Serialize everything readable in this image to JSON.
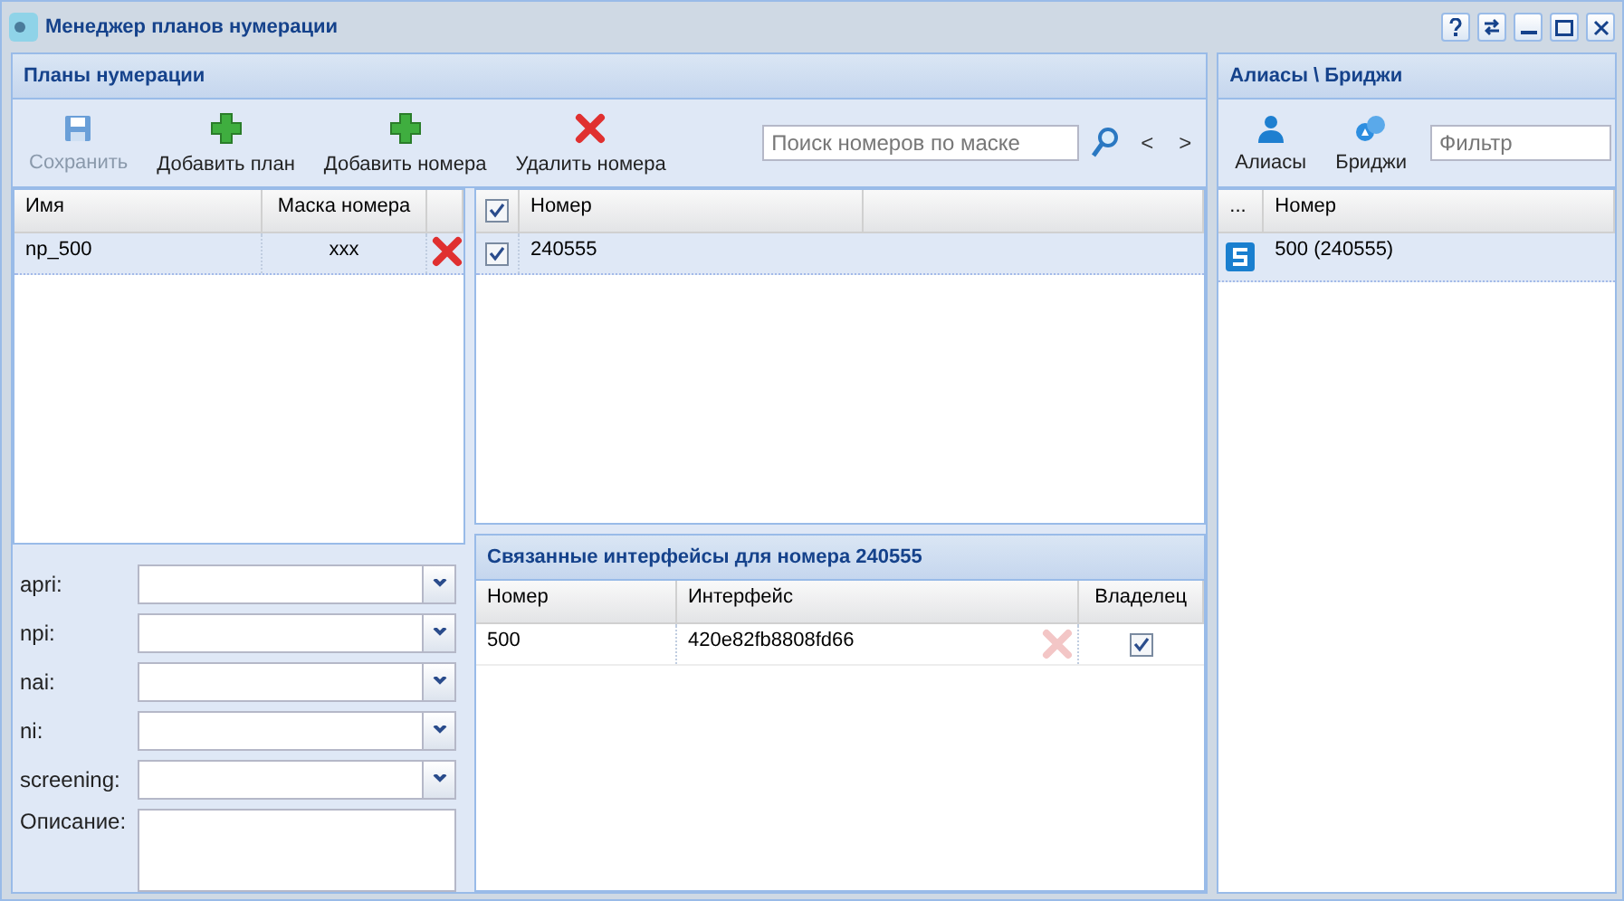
{
  "window": {
    "title": "Менеджер планов нумерации"
  },
  "plans_panel": {
    "title": "Планы нумерации",
    "toolbar": [
      {
        "label": "Сохранить",
        "kind": "save",
        "disabled": true
      },
      {
        "label": "Добавить план",
        "kind": "add",
        "disabled": false
      },
      {
        "label": "Добавить номера",
        "kind": "add",
        "disabled": false
      },
      {
        "label": "Удалить номера",
        "kind": "delete",
        "disabled": false
      }
    ],
    "search": {
      "placeholder": "Поиск номеров по маске"
    },
    "nav": [
      "<",
      ">"
    ],
    "plans_table": {
      "columns": [
        "Имя",
        "Маска номера"
      ],
      "rows": [
        {
          "name": "np_500",
          "mask": "xxx",
          "selected": true
        }
      ]
    },
    "numbers_table": {
      "header_checked": true,
      "columns": [
        "Номер"
      ],
      "rows": [
        {
          "number": "240555",
          "checked": true,
          "selected": true
        }
      ]
    },
    "form": [
      {
        "label": "apri:",
        "kind": "select"
      },
      {
        "label": "npi:",
        "kind": "select"
      },
      {
        "label": "nai:",
        "kind": "select"
      },
      {
        "label": "ni:",
        "kind": "select"
      },
      {
        "label": "screening:",
        "kind": "select"
      },
      {
        "label": "Описание:",
        "kind": "textarea"
      }
    ],
    "linked": {
      "title": "Связанные интерфейсы для номера 240555",
      "columns": [
        "Номер",
        "Интерфейс",
        "Владелец"
      ],
      "rows": [
        {
          "number": "500",
          "interface": "420e82fb8808fd66",
          "owner": true,
          "delete_disabled": true
        }
      ]
    }
  },
  "aliases_panel": {
    "title": "Алиасы \\ Бриджи",
    "toolbar": [
      {
        "label": "Алиасы",
        "kind": "person"
      },
      {
        "label": "Бриджи",
        "kind": "bridge"
      }
    ],
    "filter": {
      "placeholder": "Фильтр"
    },
    "table": {
      "columns": [
        "...",
        "Номер"
      ],
      "rows": [
        {
          "label": "500 (240555)",
          "selected": true
        }
      ]
    }
  }
}
